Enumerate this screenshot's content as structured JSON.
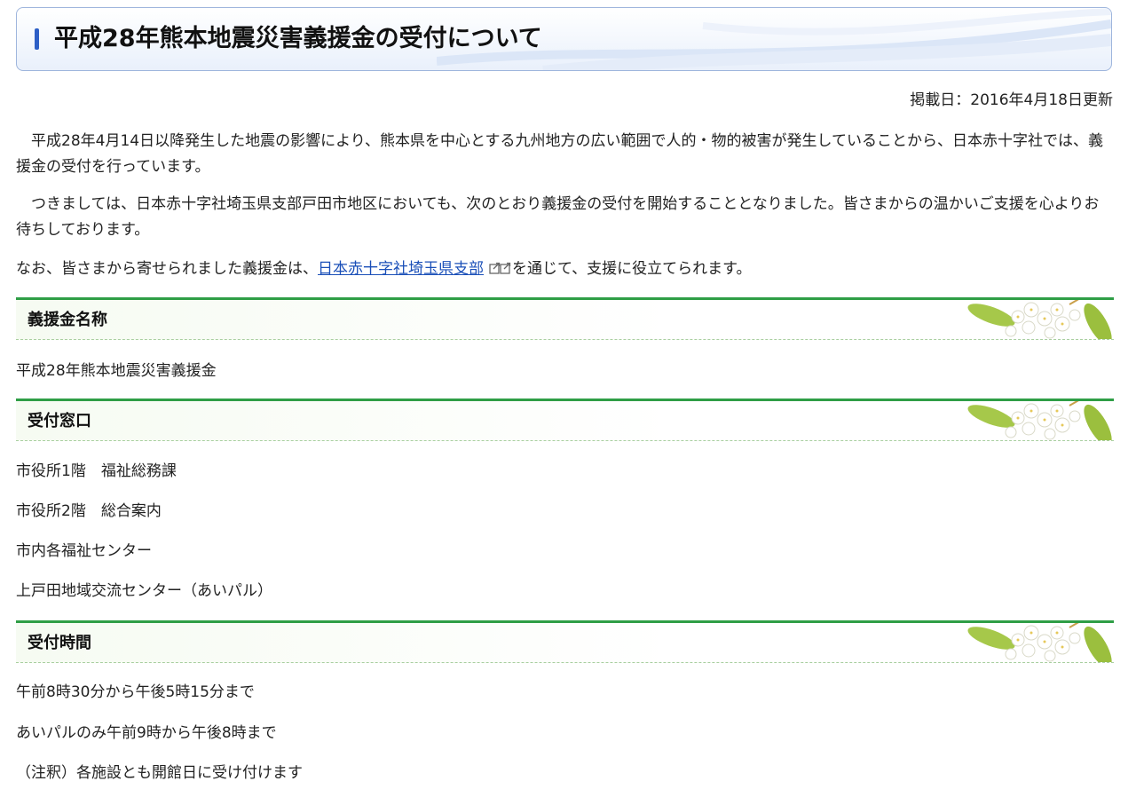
{
  "page": {
    "title": "平成28年熊本地震災害義援金の受付について",
    "posted": "掲載日：2016年4月18日更新",
    "intro_1": "　平成28年4月14日以降発生した地震の影響により、熊本県を中心とする九州地方の広い範囲で人的・物的被害が発生していることから、日本赤十字社では、義援金の受付を行っています。",
    "intro_2": "　つきましては、日本赤十字社埼玉県支部戸田市地区においても、次のとおり義援金の受付を開始することとなりました。皆さまからの温かいご支援を心よりお待ちしております。",
    "intro_3_prefix": "なお、皆さまから寄せられました義援金は、",
    "intro_3_link": "日本赤十字社埼玉県支部",
    "intro_3_suffix": "を通じて、支援に役立てられます。",
    "external_link_icon": "external-link-icon"
  },
  "sections": [
    {
      "heading": "義援金名称",
      "lines": [
        "平成28年熊本地震災害義援金"
      ]
    },
    {
      "heading": "受付窓口",
      "lines": [
        "市役所1階　福祉総務課",
        "市役所2階　総合案内",
        "市内各福祉センター",
        "上戸田地域交流センター（あいパル）"
      ]
    },
    {
      "heading": "受付時間",
      "lines": [
        "午前8時30分から午後5時15分まで",
        "あいパルのみ午前9時から午後8時まで",
        "（注釈）各施設とも開館日に受け付けます"
      ]
    }
  ],
  "colors": {
    "title_accent": "#2d5fc6",
    "section_rule": "#2f9e46",
    "link": "#1a4fb8"
  }
}
